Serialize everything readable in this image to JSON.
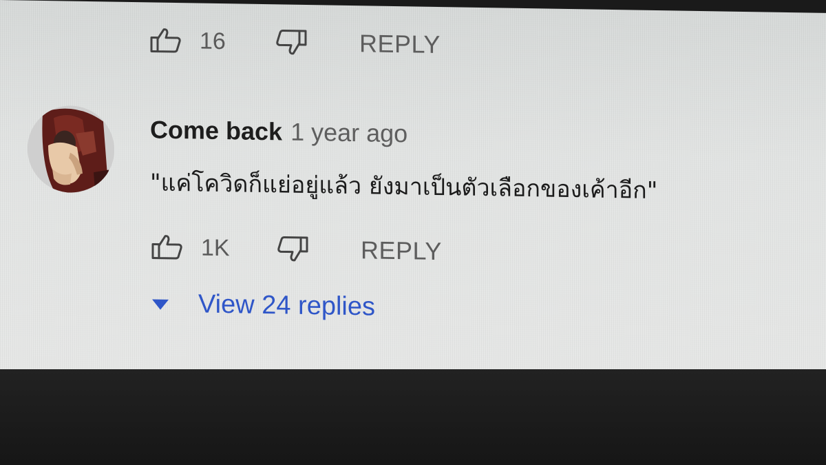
{
  "previous_comment": {
    "like_count": "16",
    "reply_label": "REPLY"
  },
  "comment": {
    "author": "Come back",
    "timestamp": "1 year ago",
    "text": "\"แค่โควิดก็แย่อยู่แล้ว ยังมาเป็นตัวเลือกของเค้าอีก\"",
    "like_count": "1K",
    "reply_label": "REPLY",
    "view_replies_label": "View 24 replies"
  },
  "icons": {
    "like": "thumbs-up-icon",
    "dislike": "thumbs-down-icon",
    "expand": "caret-down-icon"
  },
  "colors": {
    "link_blue": "#2f56c8",
    "screen_bg": "#e2e4e3"
  }
}
